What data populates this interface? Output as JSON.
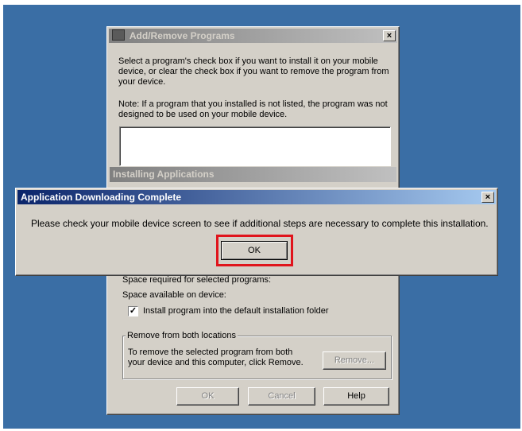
{
  "background_window": {
    "title": "Add/Remove Programs",
    "intro": "Select a program's check box if you want to install it on your mobile device, or clear the check box if you want to remove the program from your device.",
    "note": "Note:  If a program that you installed is not listed, the program was not designed to be used on your mobile device.",
    "installing_title": "Installing Applications",
    "space_required": "Space required for selected programs:",
    "space_available": "Space available on device:",
    "install_checkbox_label": "Install program into the default installation folder",
    "install_checkbox_checked": true,
    "group_title": "Remove from both locations",
    "group_text": "To remove the selected program from both your device and this computer, click Remove.",
    "remove_button": "Remove...",
    "ok_button": "OK",
    "cancel_button": "Cancel",
    "help_button": "Help"
  },
  "dialog": {
    "title": "Application Downloading Complete",
    "message": "Please check your mobile device screen to see if additional steps are necessary to complete this installation.",
    "ok_button": "OK"
  },
  "colors": {
    "desktop": "#3a6ea5",
    "highlight_box": "#e0141c",
    "active_title_start": "#0a246a",
    "active_title_end": "#a6caf0"
  }
}
